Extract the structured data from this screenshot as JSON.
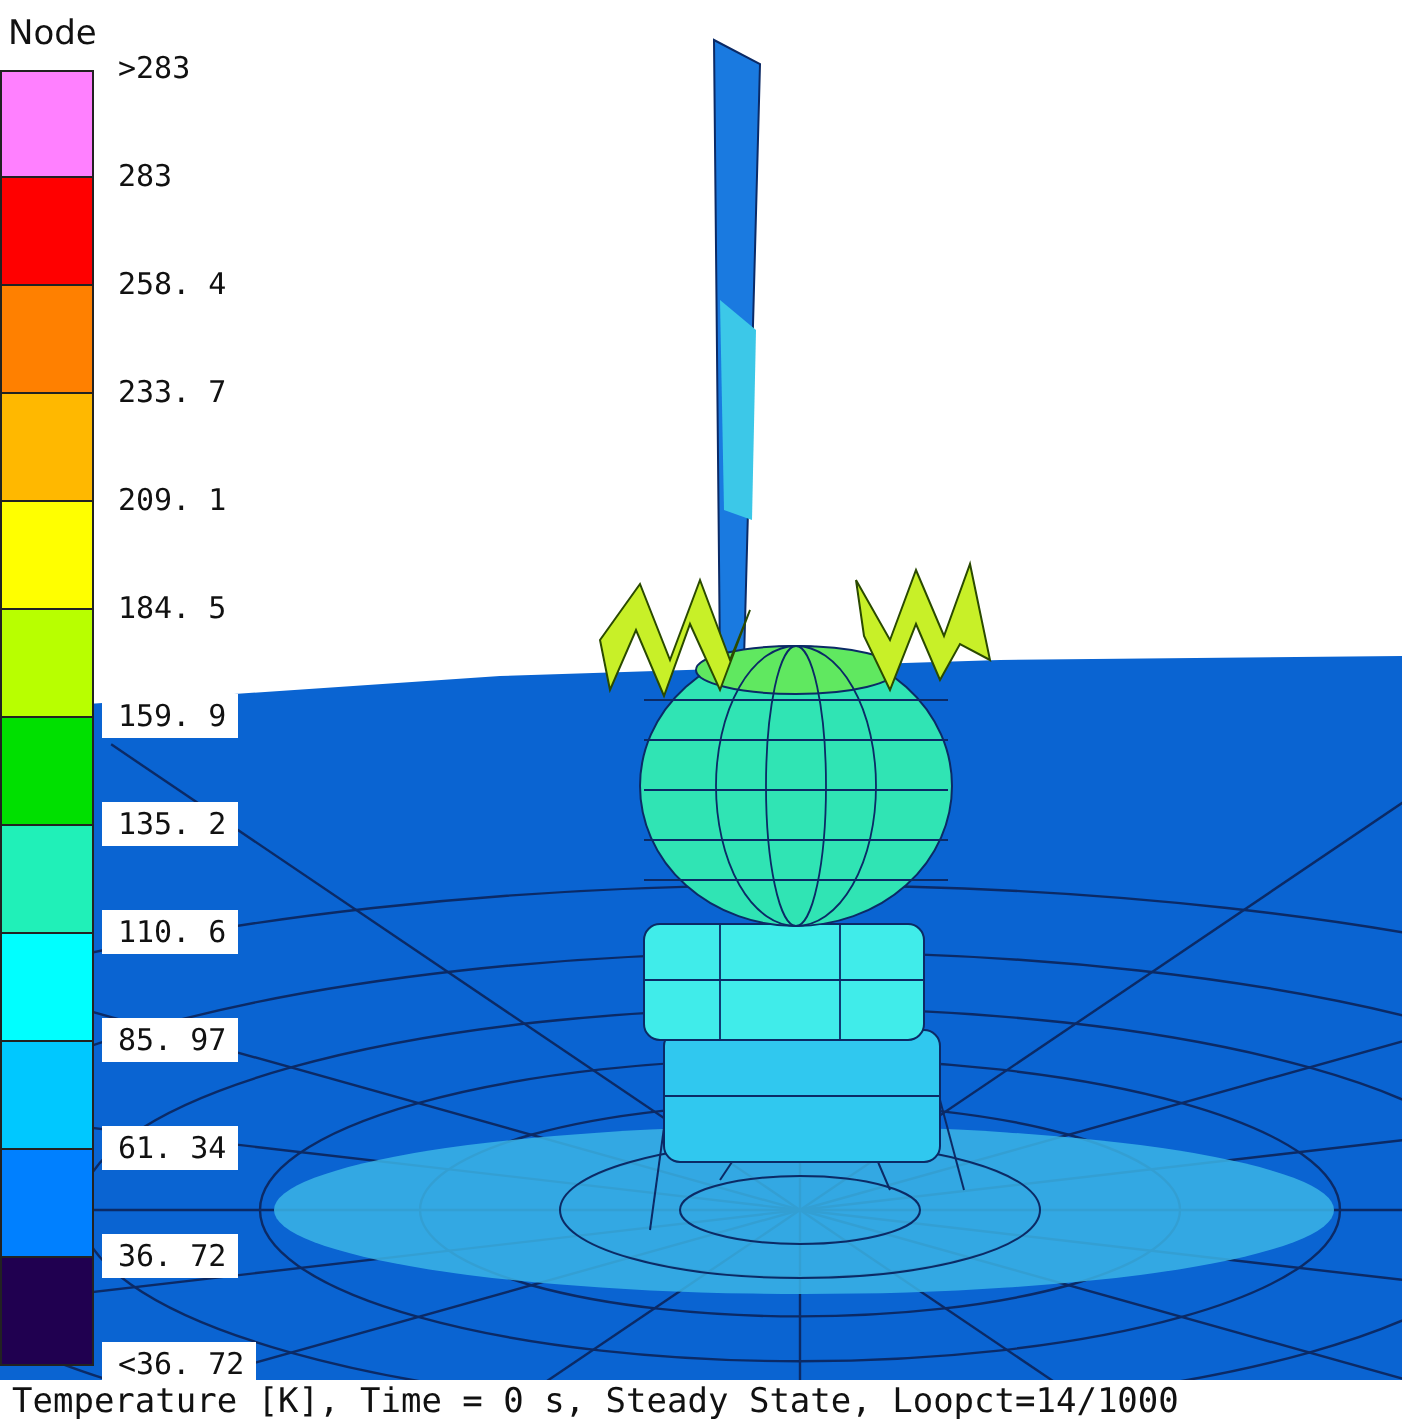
{
  "legend": {
    "title": "Node",
    "bands": [
      {
        "label": ">283",
        "color": "#ff80ff"
      },
      {
        "label": "283",
        "color": "#ff0000"
      },
      {
        "label": "258. 4",
        "color": "#ff8000"
      },
      {
        "label": "233. 7",
        "color": "#ffb800"
      },
      {
        "label": "209. 1",
        "color": "#ffff00"
      },
      {
        "label": "184. 5",
        "color": "#b8ff00"
      },
      {
        "label": "159. 9",
        "color": "#00e000"
      },
      {
        "label": "135. 2",
        "color": "#20f0b8"
      },
      {
        "label": "110. 6",
        "color": "#00ffff"
      },
      {
        "label": "85. 97",
        "color": "#00c8ff"
      },
      {
        "label": "61. 34",
        "color": "#0080ff"
      },
      {
        "label": "36. 72",
        "color": "#200050"
      }
    ],
    "bottom_label": "<36. 72"
  },
  "caption": "Temperature [K], Time = 0 s, Steady State, Loopct=14/1000"
}
